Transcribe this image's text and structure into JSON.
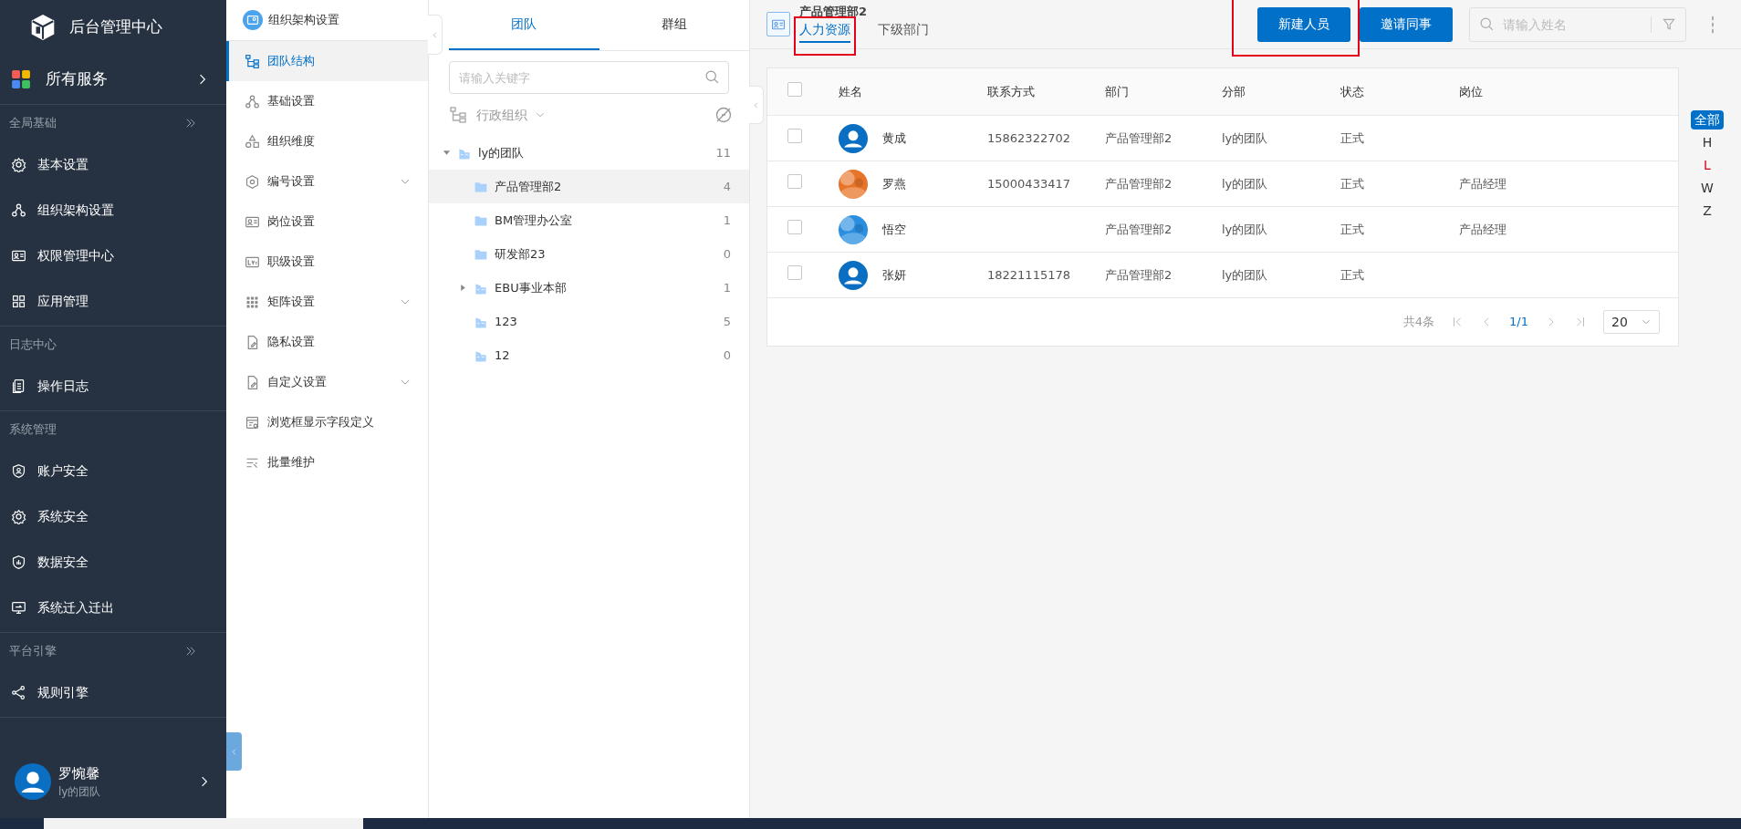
{
  "sidebar": {
    "title": "后台管理中心",
    "all_services": "所有服务",
    "sections": [
      {
        "title": "全局基础",
        "collapsible": true,
        "items": [
          {
            "label": "基本设置"
          },
          {
            "label": "组织架构设置"
          },
          {
            "label": "权限管理中心"
          },
          {
            "label": "应用管理"
          }
        ]
      },
      {
        "title": "日志中心",
        "collapsible": false,
        "items": [
          {
            "label": "操作日志"
          }
        ]
      },
      {
        "title": "系统管理",
        "collapsible": false,
        "items": [
          {
            "label": "账户安全"
          },
          {
            "label": "系统安全"
          },
          {
            "label": "数据安全"
          },
          {
            "label": "系统迁入迁出"
          }
        ]
      },
      {
        "title": "平台引擎",
        "collapsible": true,
        "items": [
          {
            "label": "规则引擎"
          }
        ]
      }
    ],
    "user": {
      "name": "罗惋馨",
      "team": "ly的团队"
    }
  },
  "settings_menu": {
    "title": "组织架构设置",
    "items": [
      {
        "label": "团队结构",
        "selected": true,
        "has_submenu": false
      },
      {
        "label": "基础设置",
        "selected": false,
        "has_submenu": false
      },
      {
        "label": "组织维度",
        "selected": false,
        "has_submenu": false
      },
      {
        "label": "编号设置",
        "selected": false,
        "has_submenu": true
      },
      {
        "label": "岗位设置",
        "selected": false,
        "has_submenu": false
      },
      {
        "label": "职级设置",
        "selected": false,
        "has_submenu": false
      },
      {
        "label": "矩阵设置",
        "selected": false,
        "has_submenu": true
      },
      {
        "label": "隐私设置",
        "selected": false,
        "has_submenu": false
      },
      {
        "label": "自定义设置",
        "selected": false,
        "has_submenu": true
      },
      {
        "label": "浏览框显示字段定义",
        "selected": false,
        "has_submenu": false
      },
      {
        "label": "批量维护",
        "selected": false,
        "has_submenu": false
      }
    ]
  },
  "tree_panel": {
    "tabs": [
      {
        "label": "团队",
        "selected": true
      },
      {
        "label": "群组",
        "selected": false
      }
    ],
    "search": {
      "placeholder": "请输入关键字"
    },
    "view": "行政组织",
    "nodes": [
      {
        "label": "ly的团队",
        "count": "11",
        "kind": "team",
        "expanded": true,
        "selected": false,
        "children": [
          {
            "label": "产品管理部2",
            "count": "4",
            "kind": "department",
            "selected": true
          },
          {
            "label": "BM管理办公室",
            "count": "1",
            "kind": "department",
            "selected": false
          },
          {
            "label": "研发部23",
            "count": "0",
            "kind": "department",
            "selected": false
          },
          {
            "label": "EBU事业本部",
            "count": "1",
            "kind": "team",
            "expanded": false,
            "selected": false
          },
          {
            "label": "123",
            "count": "5",
            "kind": "team",
            "selected": false
          },
          {
            "label": "12",
            "count": "0",
            "kind": "team",
            "selected": false
          }
        ]
      }
    ]
  },
  "department": {
    "title": "产品管理部2",
    "tabs": [
      {
        "label": "人力资源",
        "selected": true,
        "outlined": true
      },
      {
        "label": "下级部门",
        "selected": false,
        "outlined": false
      }
    ]
  },
  "actions": [
    {
      "label": "新建人员",
      "outlined": true
    },
    {
      "label": "邀请同事",
      "outlined": false
    }
  ],
  "name_search": {
    "placeholder": "请输入姓名"
  },
  "table": {
    "all_checked": false,
    "columns": [
      "姓名",
      "联系方式",
      "部门",
      "分部",
      "状态",
      "岗位"
    ],
    "rows": [
      {
        "checked": false,
        "avatar": {
          "kind": "default"
        },
        "name": "黄成",
        "phone": "15862322702",
        "department": "产品管理部2",
        "branch": "ly的团队",
        "status": "正式"
      },
      {
        "checked": false,
        "name": "罗燕",
        "phone": "15000433417",
        "department": "产品管理部2",
        "branch": "ly的团队",
        "status": "正式",
        "position": "产品经理"
      },
      {
        "checked": false,
        "name": "悟空",
        "department": "产品管理部2",
        "branch": "ly的团队",
        "status": "正式",
        "position": "产品经理"
      },
      {
        "checked": false,
        "avatar": {
          "kind": "default"
        },
        "name": "张妍",
        "phone": "18221115178",
        "department": "产品管理部2",
        "branch": "ly的团队",
        "status": "正式"
      }
    ]
  },
  "pagination": {
    "total": "共4条",
    "page": "1/1",
    "page_size": "20"
  },
  "letter_index": [
    {
      "label": "全部",
      "selected": true
    },
    {
      "label": "H",
      "selected": false,
      "color": "#333333"
    },
    {
      "label": "L",
      "selected": false,
      "color": "#d9001b"
    },
    {
      "label": "W",
      "selected": false,
      "color": "#333333"
    },
    {
      "label": "Z",
      "selected": false,
      "color": "#333333"
    }
  ]
}
